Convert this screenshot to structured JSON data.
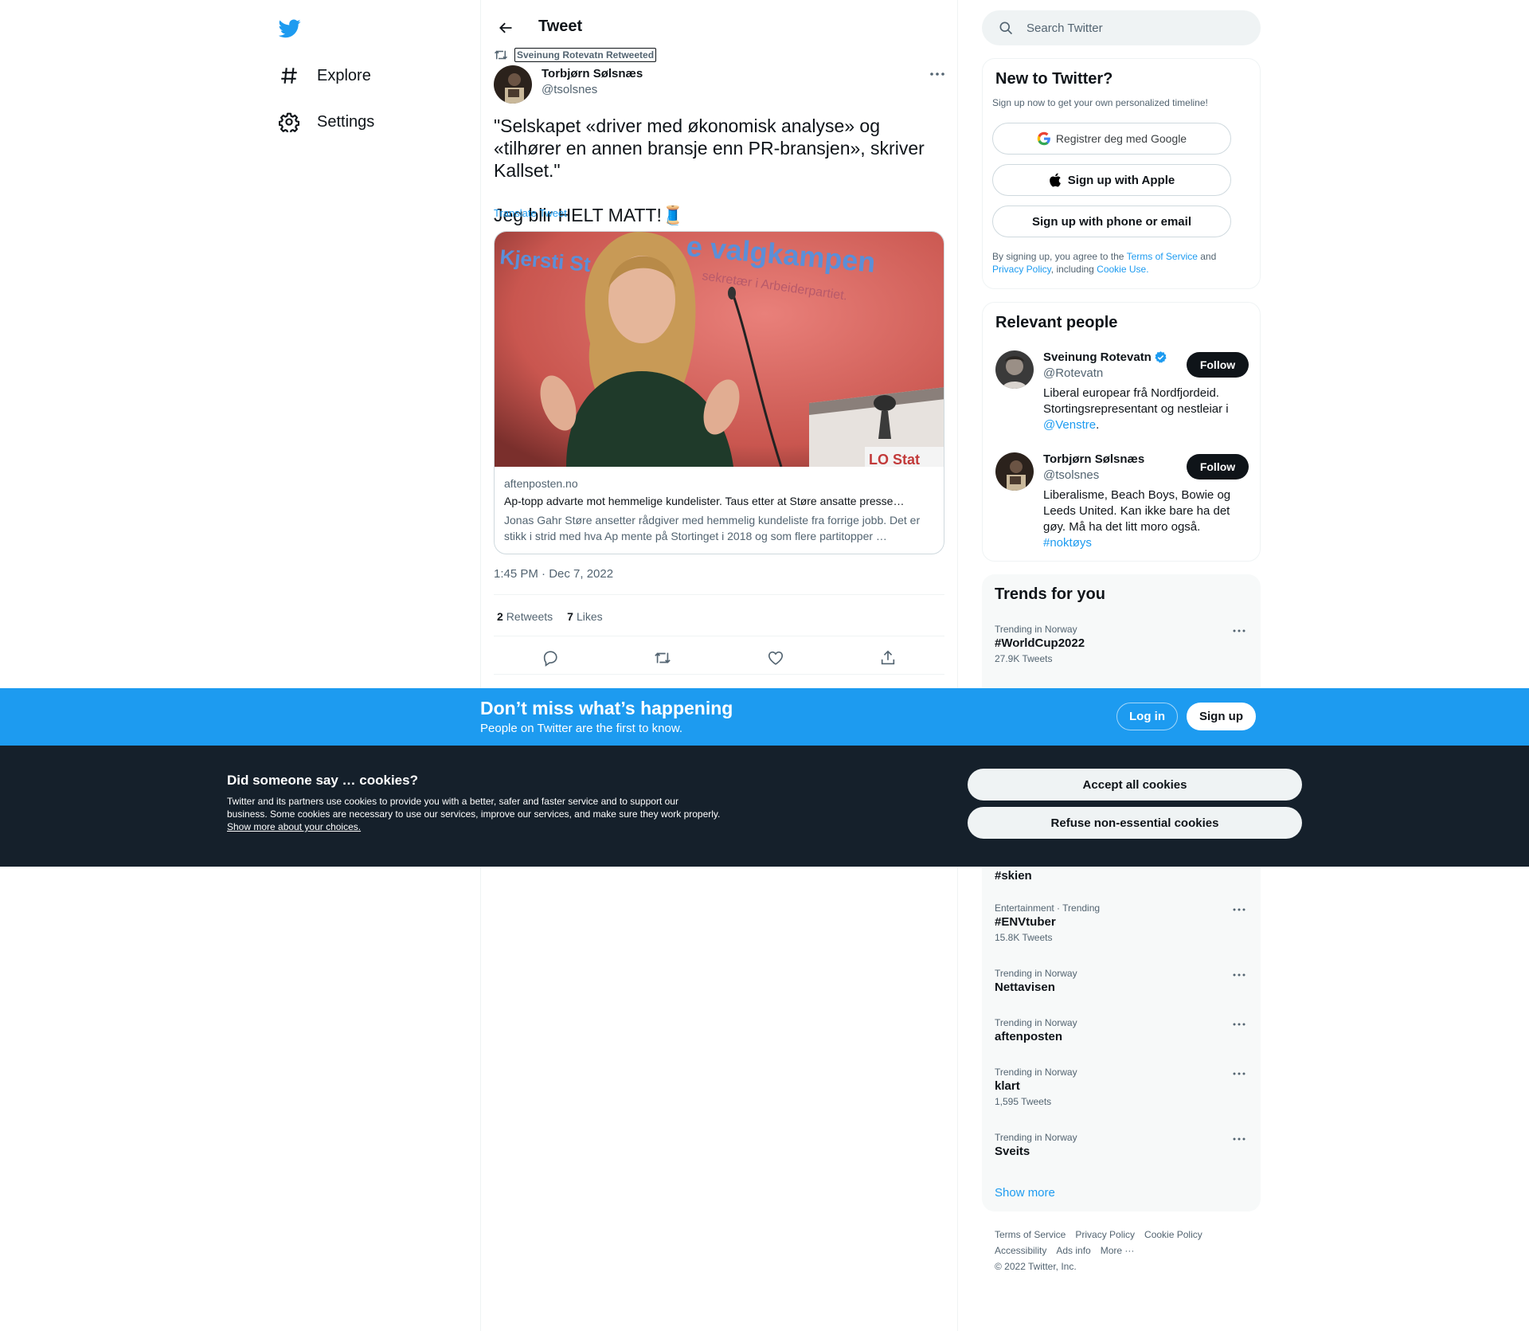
{
  "nav": {
    "items": [
      {
        "label": "Explore",
        "icon": "hashtag-icon"
      },
      {
        "label": "Settings",
        "icon": "gear-icon"
      }
    ]
  },
  "header": {
    "title": "Tweet"
  },
  "tweet": {
    "retweeted_by": "Sveinung Rotevatn Retweeted",
    "author_name": "Torbjørn Sølsnæs",
    "author_handle": "@tsolsnes",
    "text": "\"Selskapet «driver med økonomisk analyse» og «tilhører en annen bransje enn PR-bransjen», skriver Kallset.\"\n\nJeg blir HELT MATT!🧵",
    "translate": "Translate Tweet",
    "card": {
      "image_text_1": "Kjersti St",
      "image_text_2": "e valgkampen",
      "image_text_3": "sekretær i Arbeiderpartiet.",
      "image_text_4": "LO Stat",
      "domain": "aftenposten.no",
      "title": "Ap-topp advarte mot hemmelige kundelister. Taus etter at Støre ansatte presse…",
      "description": "Jonas Gahr Støre ansetter rådgiver med hemmelig kundeliste fra forrige jobb. Det er stikk i strid med hva Ap mente på Stortinget i 2018 og som flere partitopper …"
    },
    "timestamp": "1:45 PM · Dec 7, 2022",
    "retweets_count": "2",
    "retweets_label": "Retweets",
    "likes_count": "7",
    "likes_label": "Likes"
  },
  "search": {
    "placeholder": "Search Twitter"
  },
  "new_to_twitter": {
    "title": "New to Twitter?",
    "subtitle": "Sign up now to get your own personalized timeline!",
    "google_label": "Registrer deg med Google",
    "apple_label": "Sign up with Apple",
    "phone_label": "Sign up with phone or email",
    "terms_prefix": "By signing up, you agree to the ",
    "terms_link": "Terms of Service",
    "terms_and": " and ",
    "privacy_link": "Privacy Policy",
    "terms_including": ", including ",
    "cookie_link": "Cookie Use."
  },
  "relevant_people": {
    "title": "Relevant people",
    "people": [
      {
        "name": "Sveinung Rotevatn",
        "handle": "@Rotevatn",
        "bio": "Liberal europear frå Nordfjordeid. Stortingsrepresentant og nestleiar i ",
        "bio_link": "@Venstre",
        "bio_end": ".",
        "follow": "Follow"
      },
      {
        "name": "Torbjørn Sølsnæs",
        "handle": "@tsolsnes",
        "bio": "Liberalisme, Beach Boys, Bowie og Leeds United. Kan ikke bare ha det gøy. Må ha det litt moro også. ",
        "bio_link": "#noktøys",
        "follow": "Follow"
      }
    ]
  },
  "trends": {
    "title": "Trends for you",
    "items": [
      {
        "meta": "Trending in Norway",
        "name": "#WorldCup2022",
        "count": "27.9K Tweets"
      },
      {
        "meta": "",
        "name": "#skien",
        "count": ""
      },
      {
        "meta": "Entertainment · Trending",
        "name": "#ENVtuber",
        "count": "15.8K Tweets"
      },
      {
        "meta": "Trending in Norway",
        "name": "Nettavisen",
        "count": ""
      },
      {
        "meta": "Trending in Norway",
        "name": "aftenposten",
        "count": ""
      },
      {
        "meta": "Trending in Norway",
        "name": "klart",
        "count": "1,595 Tweets"
      },
      {
        "meta": "Trending in Norway",
        "name": "Sveits",
        "count": ""
      }
    ],
    "show_more": "Show more"
  },
  "footer": {
    "links": [
      "Terms of Service",
      "Privacy Policy",
      "Cookie Policy",
      "Accessibility",
      "Ads info",
      "More ···"
    ],
    "copyright": "© 2022 Twitter, Inc."
  },
  "banner": {
    "title": "Don’t miss what’s happening",
    "subtitle": "People on Twitter are the first to know.",
    "login": "Log in",
    "signup": "Sign up"
  },
  "cookies": {
    "title": "Did someone say … cookies?",
    "text": "Twitter and its partners use cookies to provide you with a better, safer and faster service and to support our business. Some cookies are necessary to use our services, improve our services, and make sure they work properly. ",
    "link": "Show more about your choices.",
    "accept": "Accept all cookies",
    "refuse": "Refuse non-essential cookies"
  },
  "colors": {
    "accent": "#1d9bf0",
    "cookie_bg": "#15202b",
    "text": "#0f1419",
    "muted": "#536471"
  }
}
